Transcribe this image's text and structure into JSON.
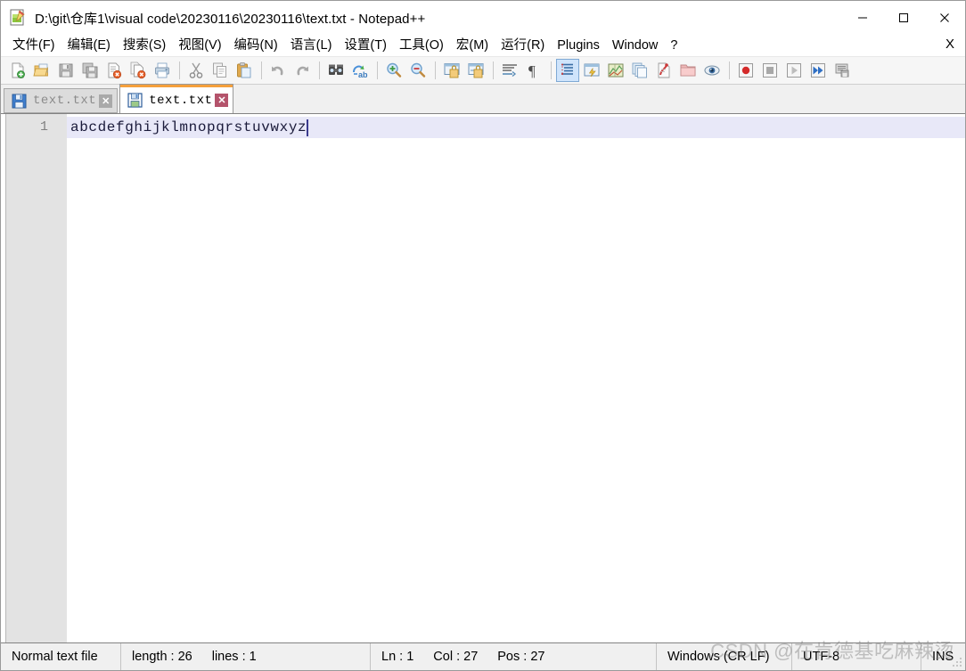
{
  "window": {
    "title": "D:\\git\\仓库1\\visual code\\20230116\\20230116\\text.txt - Notepad++",
    "app_icon": "notepad-plus-plus-icon",
    "controls": {
      "minimize": "—",
      "maximize": "☐",
      "close": "✕"
    }
  },
  "menubar": {
    "items": [
      {
        "label": "文件(F)",
        "name": "file"
      },
      {
        "label": "编辑(E)",
        "name": "edit"
      },
      {
        "label": "搜索(S)",
        "name": "search"
      },
      {
        "label": "视图(V)",
        "name": "view"
      },
      {
        "label": "编码(N)",
        "name": "encoding"
      },
      {
        "label": "语言(L)",
        "name": "language"
      },
      {
        "label": "设置(T)",
        "name": "settings"
      },
      {
        "label": "工具(O)",
        "name": "tools"
      },
      {
        "label": "宏(M)",
        "name": "macro"
      },
      {
        "label": "运行(R)",
        "name": "run"
      },
      {
        "label": "Plugins",
        "name": "plugins"
      },
      {
        "label": "Window",
        "name": "window"
      },
      {
        "label": "?",
        "name": "help"
      }
    ],
    "close_document": "X"
  },
  "toolbar": {
    "groups": [
      [
        "new-file-icon",
        "open-file-icon",
        "save-icon",
        "save-all-icon",
        "close-file-icon",
        "close-all-files-icon",
        "print-icon"
      ],
      [
        "cut-icon",
        "copy-icon",
        "paste-icon"
      ],
      [
        "undo-icon",
        "redo-icon"
      ],
      [
        "find-icon",
        "replace-icon"
      ],
      [
        "zoom-in-icon",
        "zoom-out-icon"
      ],
      [
        "sync-vertical-scroll-icon",
        "sync-horizontal-scroll-icon"
      ],
      [
        "word-wrap-icon",
        "show-all-characters-icon"
      ],
      [
        "indent-guide-icon",
        "user-defined-dialog-icon",
        "document-map-icon",
        "function-list-icon",
        "folder-as-workspace-icon",
        "folder-icon",
        "monitoring-icon"
      ],
      [
        "macro-record-icon",
        "macro-stop-icon",
        "macro-play-icon",
        "macro-play-multiple-icon",
        "macro-save-icon"
      ]
    ],
    "active_button": "indent-guide-icon"
  },
  "tabs": [
    {
      "label": "text.txt",
      "active": false,
      "icon": "save-blue-icon",
      "close": "✕"
    },
    {
      "label": "text.txt",
      "active": true,
      "icon": "save-blue-icon",
      "close": "✕"
    }
  ],
  "editor": {
    "line_numbers": [
      "1"
    ],
    "lines": [
      "abcdefghijklmnopqrstuvwxyz"
    ]
  },
  "statusbar": {
    "file_type": "Normal text file",
    "length_label": "length : 26",
    "lines_label": "lines : 1",
    "ln": "Ln : 1",
    "col": "Col : 27",
    "pos": "Pos : 27",
    "eol": "Windows (CR LF)",
    "encoding": "UTF-8",
    "insert_mode": "INS"
  },
  "watermark": {
    "text": "CSDN @在肯德基吃麻辣烫"
  },
  "colors": {
    "active_tab_accent": "#f5a03c",
    "active_line": "#e8e8f8",
    "gutter": "#e3e3e3",
    "toolbar_active": "#cfe4fb"
  }
}
